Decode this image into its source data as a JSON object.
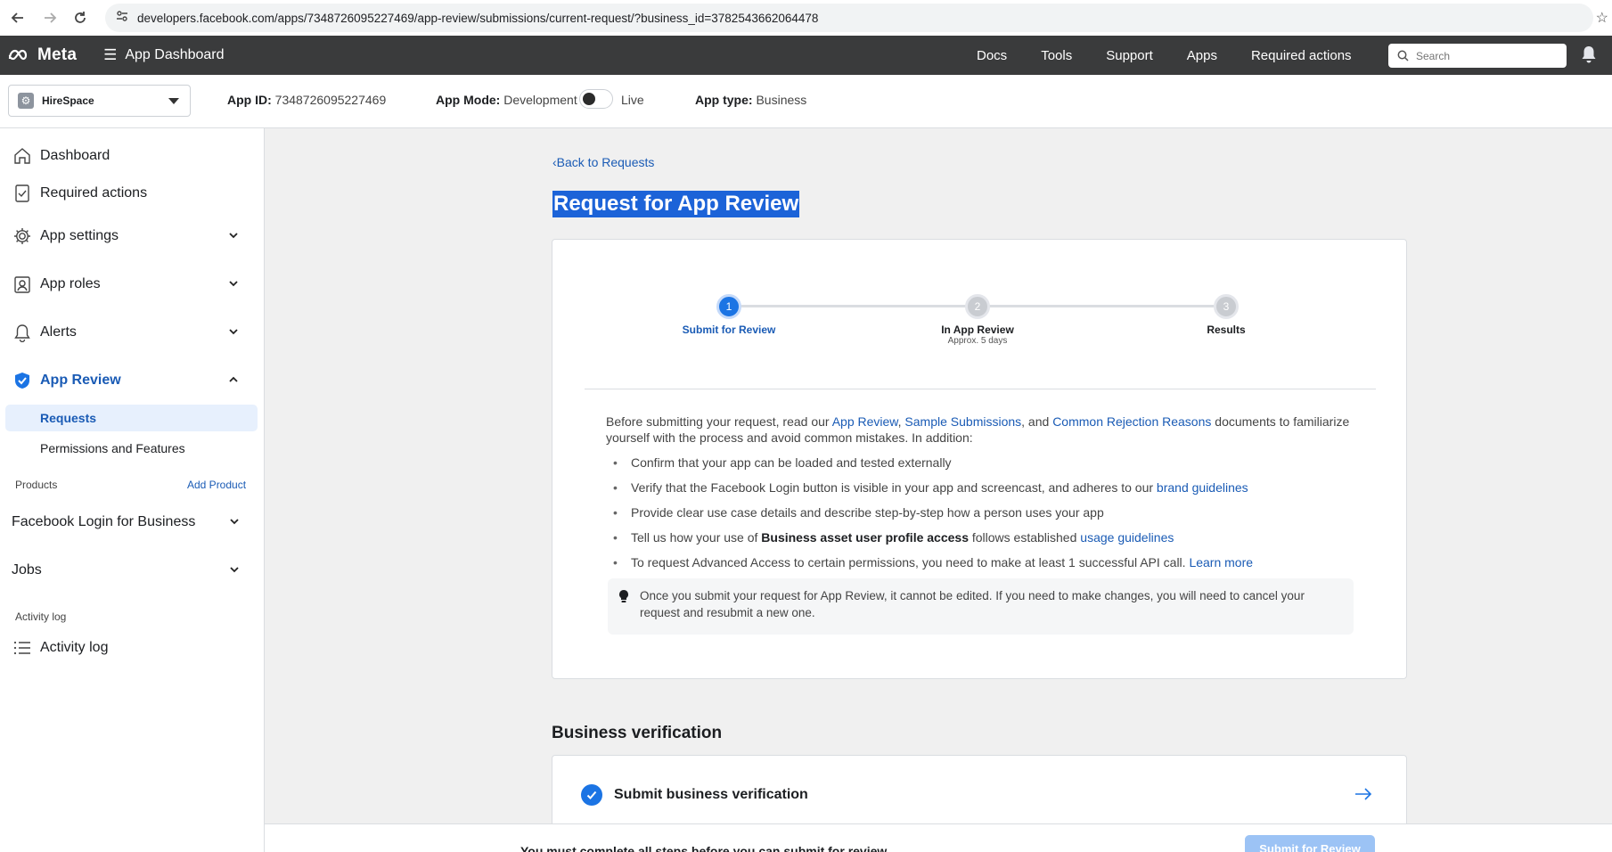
{
  "browser": {
    "url": "developers.facebook.com/apps/7348726095227469/app-review/submissions/current-request/?business_id=3782543662064478"
  },
  "header": {
    "brand": "Meta",
    "menu_label": "App Dashboard",
    "links": [
      "Docs",
      "Tools",
      "Support",
      "Apps",
      "Required actions"
    ],
    "search_placeholder": "Search"
  },
  "subheader": {
    "app_name": "HireSpace",
    "app_id_label": "App ID:",
    "app_id": "7348726095227469",
    "app_mode_label": "App Mode:",
    "app_mode": "Development",
    "live_label": "Live",
    "app_type_label": "App type:",
    "app_type": "Business"
  },
  "sidebar": {
    "items": [
      {
        "label": "Dashboard",
        "icon": "home-icon"
      },
      {
        "label": "Required actions",
        "icon": "checklist-icon"
      },
      {
        "label": "App settings",
        "icon": "gear-icon"
      },
      {
        "label": "App roles",
        "icon": "person-badge-icon"
      },
      {
        "label": "Alerts",
        "icon": "bell-icon"
      },
      {
        "label": "App Review",
        "icon": "shield-check-icon"
      }
    ],
    "sub_items": [
      "Requests",
      "Permissions and Features"
    ],
    "products_label": "Products",
    "add_product": "Add Product",
    "product_items": [
      "Facebook Login for Business",
      "Jobs"
    ],
    "activity_section_label": "Activity log",
    "activity_item": "Activity log"
  },
  "main": {
    "back_link": "Back to Requests",
    "title": "Request for App Review",
    "steps": [
      {
        "number": "1",
        "label": "Submit for Review",
        "sub": ""
      },
      {
        "number": "2",
        "label": "In App Review",
        "sub": "Approx. 5 days"
      },
      {
        "number": "3",
        "label": "Results",
        "sub": ""
      }
    ],
    "intro": {
      "t1": "Before submitting your request, read our ",
      "l1": "App Review",
      "t2": ", ",
      "l2": "Sample Submissions",
      "t3": ", and ",
      "l3": "Common Rejection Reasons",
      "t4": " documents to familiarize yourself with the process and avoid common mistakes. In addition:"
    },
    "bullets": {
      "b1": "Confirm that your app can be loaded and tested externally",
      "b2_text": "Verify that the Facebook Login button is visible in your app and screencast, and adheres to our ",
      "b2_link": "brand guidelines",
      "b3": "Provide clear use case details and describe step-by-step how a person uses your app",
      "b4_pre": "Tell us how your use of ",
      "b4_bold": "Business asset user profile access",
      "b4_mid": " follows established ",
      "b4_link": "usage guidelines",
      "b5_text": "To request Advanced Access to certain permissions, you need to make at least 1 successful API call. ",
      "b5_link": "Learn more"
    },
    "notice": "Once you submit your request for App Review, it cannot be edited. If you need to make changes, you will need to cancel your request and resubmit a new one.",
    "business_section_title": "Business verification",
    "business_item": "Submit business verification"
  },
  "footer": {
    "message": "You must complete all steps before you can submit for review.",
    "submit_label": "Submit for Review"
  },
  "colors": {
    "accent": "#1b74e4",
    "link": "#1a5bb5",
    "header_bg": "#3a3b3c",
    "page_bg": "#f0f0f0"
  }
}
